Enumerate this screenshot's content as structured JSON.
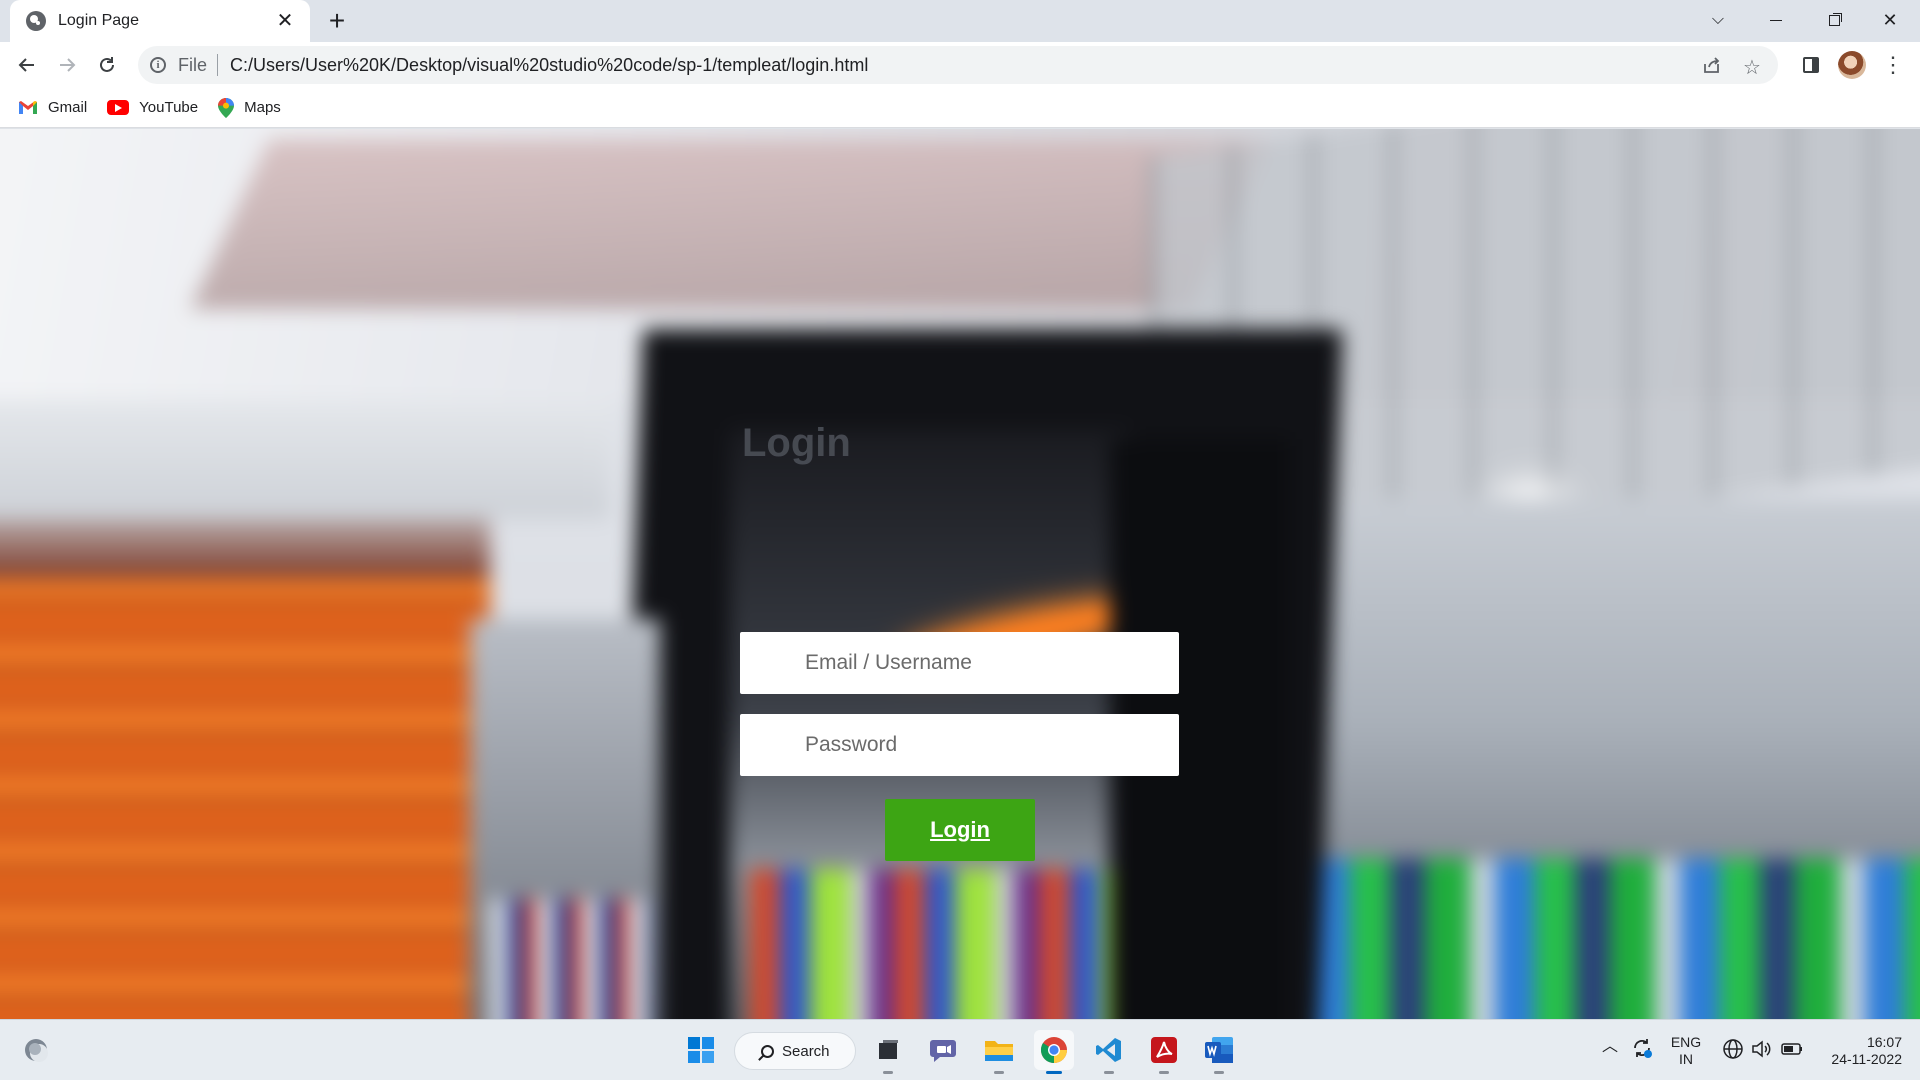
{
  "browser": {
    "tab_title": "Login Page",
    "new_tab_label": "+",
    "url_scheme": "File",
    "url": "C:/Users/User%20K/Desktop/visual%20studio%20code/sp-1/templeat/login.html",
    "bookmarks": [
      {
        "label": "Gmail",
        "icon": "gmail-icon"
      },
      {
        "label": "YouTube",
        "icon": "youtube-icon"
      },
      {
        "label": "Maps",
        "icon": "maps-icon"
      }
    ]
  },
  "login": {
    "title": "Login",
    "email_placeholder": "Email / Username",
    "password_placeholder": "Password",
    "button_label": "Login",
    "button_color": "#3da514"
  },
  "taskbar": {
    "search_label": "Search",
    "apps": [
      "start-icon",
      "task-view-icon",
      "teams-chat-icon",
      "file-explorer-icon",
      "chrome-icon",
      "vscode-icon",
      "acrobat-icon",
      "word-icon"
    ],
    "language": "ENG",
    "region": "IN",
    "time": "16:07",
    "date": "24-11-2022"
  }
}
